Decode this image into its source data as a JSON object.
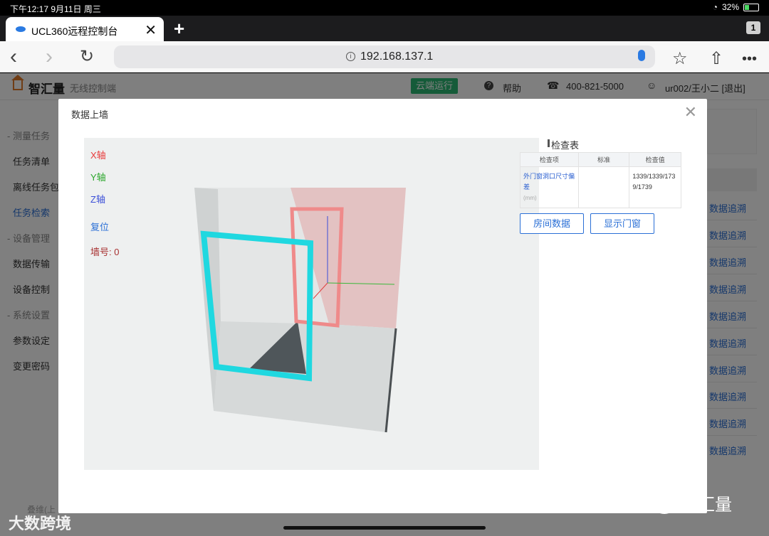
{
  "status_bar": {
    "time": "下午12:17   9月11日 周三",
    "battery": "32%",
    "battery_level": 0.32
  },
  "browser": {
    "tab_title": "UCL360远程控制台",
    "new_tab": "+",
    "tab_count": "1",
    "url": "192.168.137.1"
  },
  "app": {
    "logo": "智汇量",
    "subtitle": "无线控制端",
    "cloud_button": "云端运行",
    "help": "帮助",
    "phone": "400-821-5000",
    "user": "ur002/王小二 [退出]"
  },
  "sidebar": {
    "groups": [
      {
        "title": "- 测量任务",
        "items": [
          "任务清单",
          "离线任务包",
          "任务检索"
        ]
      },
      {
        "title": "- 设备管理",
        "items": [
          "数据传输",
          "设备控制"
        ]
      },
      {
        "title": "- 系统设置",
        "items": [
          "参数设定",
          "变更密码"
        ]
      }
    ],
    "active": "任务检索",
    "footer": "叠维(上"
  },
  "trace_links": [
    "数据追溯",
    "数据追溯",
    "数据追溯",
    "数据追溯",
    "数据追溯",
    "数据追溯",
    "数据追溯",
    "数据追溯",
    "数据追溯",
    "数据追溯"
  ],
  "modal": {
    "title": "数据上墙",
    "viewer": {
      "x_axis": "X轴",
      "y_axis": "Y轴",
      "z_axis": "Z轴",
      "reset": "复位",
      "wall_no": "墙号: 0"
    },
    "check_table": {
      "title": "检查表",
      "headers": [
        "检查项",
        "标准",
        "检查值"
      ],
      "rows": [
        {
          "item": "外门窗洞口尺寸偏差",
          "unit": "(mm)",
          "standard": "",
          "value": "1339/1339/1739/1739"
        }
      ]
    },
    "buttons": {
      "room_data": "房间数据",
      "show_doors": "显示门窗"
    }
  },
  "watermarks": {
    "right": "智汇量",
    "left": "大数跨境"
  },
  "colors": {
    "accent": "#2a6fd6",
    "cloud": "#2bb673",
    "door_highlight": "#1fd8e0",
    "window_highlight": "#f08080"
  }
}
